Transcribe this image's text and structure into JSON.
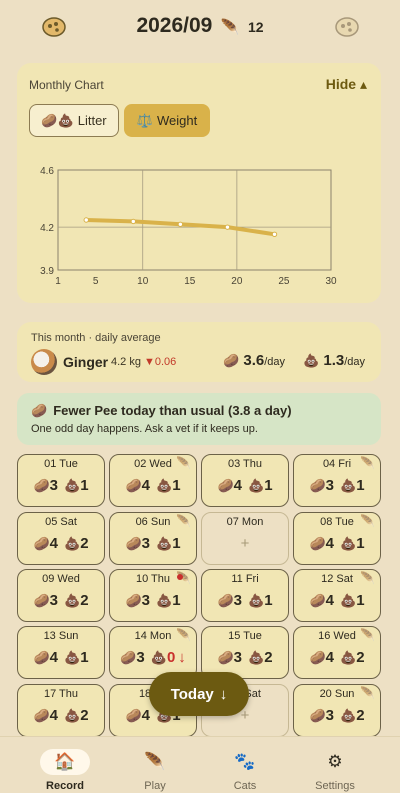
{
  "header": {
    "month": "2026/09",
    "feather_icon": "🪶",
    "feather_count": "12"
  },
  "chart_section": {
    "title": "Monthly Chart",
    "hide_label": "Hide ▴",
    "toggle_litter": "Litter",
    "toggle_weight": "Weight",
    "toggle_litter_icon": "🥔💩",
    "toggle_weight_icon": "⚖️"
  },
  "chart_data": {
    "type": "line",
    "title": "",
    "xlabel": "",
    "ylabel": "",
    "x_ticks": [
      1,
      5,
      10,
      15,
      20,
      25,
      30
    ],
    "y_ticks": [
      3.9,
      4.2,
      4.6
    ],
    "xlim": [
      1,
      30
    ],
    "ylim": [
      3.9,
      4.6
    ],
    "series": [
      {
        "color": "#d9b24a",
        "points": [
          [
            4,
            4.25
          ],
          [
            9,
            4.24
          ],
          [
            14,
            4.22
          ],
          [
            19,
            4.2
          ],
          [
            23,
            4.16
          ],
          [
            24,
            4.15
          ]
        ]
      }
    ]
  },
  "daily_avg": {
    "label": "This month · daily average",
    "cat_name": "Ginger",
    "weight": "4.2 kg",
    "delta": "▼0.06",
    "pee_icon": "🥔",
    "pee_value": "3.6",
    "poop_icon": "💩",
    "poop_value": "1.3",
    "per_day": "/day"
  },
  "alert": {
    "icon": "🥔",
    "title": "Fewer Pee today than usual (3.8 a day)",
    "subtitle": "One odd day happens. Ask a vet if it keeps up."
  },
  "days": [
    {
      "date": "01 Tue",
      "pee": "3",
      "poop": "1",
      "feather": false,
      "dot": false
    },
    {
      "date": "02 Wed",
      "pee": "4",
      "poop": "1",
      "feather": true,
      "dot": false
    },
    {
      "date": "03 Thu",
      "pee": "4",
      "poop": "1",
      "feather": false,
      "dot": false
    },
    {
      "date": "04 Fri",
      "pee": "3",
      "poop": "1",
      "feather": true,
      "dot": false
    },
    {
      "date": "05 Sat",
      "pee": "4",
      "poop": "2",
      "feather": false,
      "dot": false
    },
    {
      "date": "06 Sun",
      "pee": "3",
      "poop": "1",
      "feather": true,
      "dot": false
    },
    {
      "date": "07 Mon",
      "empty": true,
      "plus": "+"
    },
    {
      "date": "08 Tue",
      "pee": "4",
      "poop": "1",
      "feather": true,
      "dot": false
    },
    {
      "date": "09 Wed",
      "pee": "3",
      "poop": "2",
      "feather": false,
      "dot": false
    },
    {
      "date": "10 Thu",
      "pee": "3",
      "poop": "1",
      "feather": true,
      "dot": true
    },
    {
      "date": "11 Fri",
      "pee": "3",
      "poop": "1",
      "feather": false,
      "dot": false
    },
    {
      "date": "12 Sat",
      "pee": "4",
      "poop": "1",
      "feather": true,
      "dot": false
    },
    {
      "date": "13 Sun",
      "pee": "4",
      "poop": "1",
      "feather": false,
      "dot": false
    },
    {
      "date": "14 Mon",
      "pee": "3",
      "poop": "0",
      "feather": true,
      "dot": false,
      "alert": true,
      "arrow": "↓"
    },
    {
      "date": "15 Tue",
      "pee": "3",
      "poop": "2",
      "feather": false,
      "dot": false
    },
    {
      "date": "16 Wed",
      "pee": "4",
      "poop": "2",
      "feather": true,
      "dot": false
    },
    {
      "date": "17 Thu",
      "pee": "4",
      "poop": "2",
      "feather": false,
      "dot": false
    },
    {
      "date": "18 Fri",
      "pee": "4",
      "poop": "1",
      "feather": true,
      "dot": false
    },
    {
      "date": "19 Sat",
      "empty": true,
      "plus": "+"
    },
    {
      "date": "20 Sun",
      "pee": "3",
      "poop": "2",
      "feather": true,
      "dot": false
    }
  ],
  "day_icons": {
    "pee": "🥔",
    "poop": "💩",
    "feather": "🪶"
  },
  "today_button": {
    "label": "Today",
    "arrow": "↓"
  },
  "nav": {
    "items": [
      {
        "label": "Record",
        "icon": "🏠",
        "active": true
      },
      {
        "label": "Play",
        "icon": "🪶",
        "active": false
      },
      {
        "label": "Cats",
        "icon": "🐾",
        "active": false
      },
      {
        "label": "Settings",
        "icon": "⚙",
        "active": false
      }
    ]
  }
}
